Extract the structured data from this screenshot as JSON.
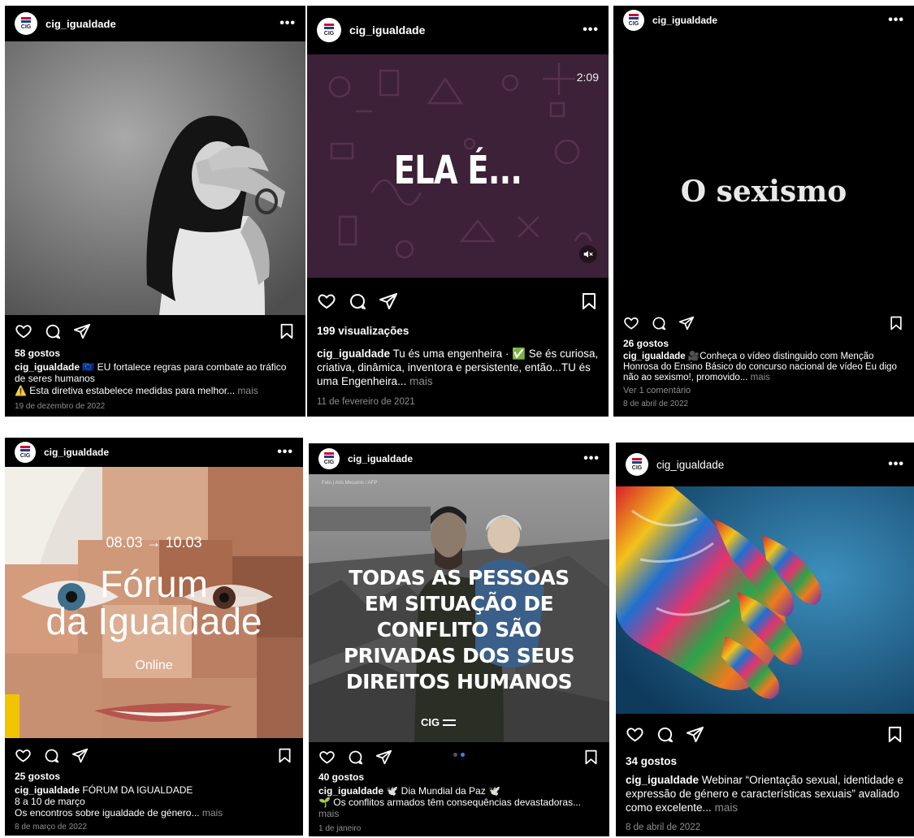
{
  "posts": [
    {
      "username": "cig_igualdade",
      "likes": "58 gostos",
      "caption_text": "🇪🇺 EU fortalece regras para combate ao tráfico de seres humanos",
      "caption_line2": "⚠️ Esta diretiva estabelece medidas para melhor...",
      "more": "mais",
      "date": "19 de dezembro de 2022"
    },
    {
      "username": "cig_igualdade",
      "video_time": "2:09",
      "overlay_text": "ELA É...",
      "views": "199 visualizações",
      "caption_text": "Tu és uma engenheira · ✅ Se és curiosa, criativa, dinâmica, inventora e persistente, então...TU és uma Engenheira...",
      "more": "mais",
      "date": "11 de fevereiro de 2021"
    },
    {
      "username": "cig_igualdade",
      "overlay_text": "O sexismo",
      "likes": "26 gostos",
      "caption_text": "🎥Conheça o vídeo distinguido com Menção Honrosa do Ensino Básico do concurso nacional de vídeo Eu digo não ao sexismo!, promovido...",
      "more": "mais",
      "comments": "Ver 1 comentário",
      "date": "8 de abril de 2022"
    },
    {
      "username": "cig_igualdade",
      "overlay_dates": "08.03 → 10.03",
      "overlay_title_1": "Fórum",
      "overlay_title_2": "da Igualdade",
      "overlay_sub": "Online",
      "likes": "25 gostos",
      "caption_text": "FÓRUM DA IGUALDADE",
      "caption_line2": "8 a 10 de março",
      "caption_line3": "Os encontros sobre igualdade de género...",
      "more": "mais",
      "date": "8 de março de 2022"
    },
    {
      "username": "cig_igualdade",
      "photo_credit": "Foto | Aris Messinis / AFP",
      "overlay_lines": [
        "TODAS AS PESSOAS",
        "EM SITUAÇÃO DE",
        "CONFLITO SÃO",
        "PRIVADAS DOS SEUS",
        "DIREITOS HUMANOS"
      ],
      "logo_text": "CIG",
      "likes": "40 gostos",
      "caption_text": "🕊️ Dia Mundial da Paz 🕊️",
      "caption_line2": "🌱 Os conflitos armados têm consequências devastadoras...",
      "more": "mais",
      "date": "1 de janeiro"
    },
    {
      "username": "cig_igualdade",
      "likes": "34 gostos",
      "caption_text": "Webinar “Orientação sexual, identidade e expressão de género e características sexuais” avaliado como excelente...",
      "more": "mais",
      "date": "8 de abril de 2022"
    }
  ],
  "avatar_label": "CIG",
  "menu_glyph": "•••",
  "colors": {
    "background": "#000000",
    "secondary_text": "#8e8e8e",
    "accent_dot": "#3b82f6"
  },
  "icons": [
    "heart-icon",
    "comment-icon",
    "share-icon",
    "bookmark-icon",
    "more-icon",
    "mute-icon"
  ]
}
